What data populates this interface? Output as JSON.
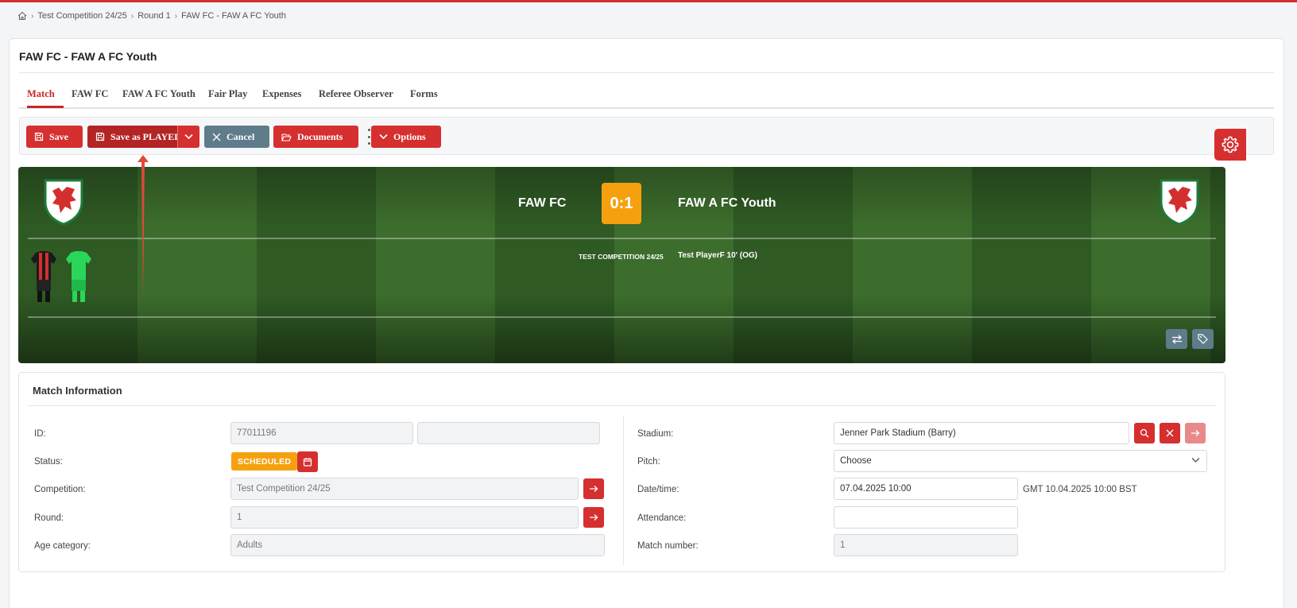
{
  "breadcrumb": {
    "items": [
      "Test Competition 24/25",
      "Round 1",
      "FAW FC - FAW A FC Youth"
    ]
  },
  "page": {
    "title": "FAW FC - FAW A FC Youth"
  },
  "tabs": [
    {
      "label": "Match",
      "active": true
    },
    {
      "label": "FAW FC"
    },
    {
      "label": "FAW A FC Youth"
    },
    {
      "label": "Fair Play"
    },
    {
      "label": "Expenses"
    },
    {
      "label": "Referee Observer"
    },
    {
      "label": "Forms"
    }
  ],
  "toolbar": {
    "save": "Save",
    "save_played": "Save as PLAYED",
    "cancel": "Cancel",
    "documents": "Documents",
    "options": "Options"
  },
  "match_header": {
    "home_team": "FAW FC",
    "away_team": "FAW A FC Youth",
    "score": "0:1",
    "event_competition": "TEST COMPETITION 24/25",
    "event_goal": "Test PlayerF 10' (OG)"
  },
  "match_info": {
    "title": "Match Information",
    "left": {
      "id_label": "ID:",
      "id_value": "77011196",
      "id_value_2": "",
      "status_label": "Status:",
      "status_value": "SCHEDULED",
      "competition_label": "Competition:",
      "competition_value": "Test Competition 24/25",
      "round_label": "Round:",
      "round_value": "1",
      "age_label": "Age category:",
      "age_value": "Adults"
    },
    "right": {
      "stadium_label": "Stadium:",
      "stadium_value": "Jenner Park Stadium (Barry)",
      "pitch_label": "Pitch:",
      "pitch_value": "Choose",
      "datetime_label": "Date/time:",
      "datetime_value": "07.04.2025 10:00",
      "tz_info": "GMT  10.04.2025 10:00  BST",
      "attendance_label": "Attendance:",
      "attendance_value": "",
      "match_number_label": "Match number:",
      "match_number_value": "1"
    }
  },
  "colors": {
    "accent": "#d62f2f",
    "accent_dark": "#b32424",
    "score_badge": "#f5a10f",
    "status_badge": "#f5a10f",
    "grey_button": "#5e7c8a"
  },
  "icons": {
    "home": "home-icon",
    "save": "floppy-icon",
    "cancel": "close-icon",
    "documents": "folder-open-icon",
    "options": "chevron-down-icon",
    "settings": "gear-icon",
    "swap": "swap-icon",
    "tag": "tag-icon",
    "calendar": "calendar-icon",
    "search": "search-icon",
    "arrow_right": "arrow-right-icon"
  }
}
